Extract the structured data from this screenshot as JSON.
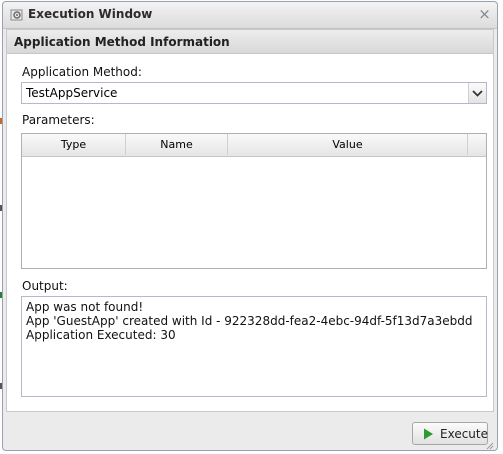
{
  "window": {
    "title": "Execution Window",
    "close_symbol": "×"
  },
  "panel": {
    "title": "Application Method Information"
  },
  "method": {
    "label": "Application Method:",
    "selected": "TestAppService"
  },
  "parameters": {
    "label": "Parameters:",
    "columns": [
      "Type",
      "Name",
      "Value"
    ],
    "rows": []
  },
  "output": {
    "label": "Output:",
    "lines": [
      "App was not found!",
      "App 'GuestApp' created with Id - 922328dd-fea2-4ebc-94df-5f13d7a3ebdd",
      "Application Executed: 30"
    ]
  },
  "actions": {
    "execute_label": "Execute"
  },
  "colors": {
    "execute_icon": "#2e9b2e"
  },
  "icons": {
    "window_icon": "gear-window-icon",
    "close_icon": "close-icon",
    "dropdown_icon": "chevron-down-icon",
    "execute_icon": "play-icon"
  }
}
